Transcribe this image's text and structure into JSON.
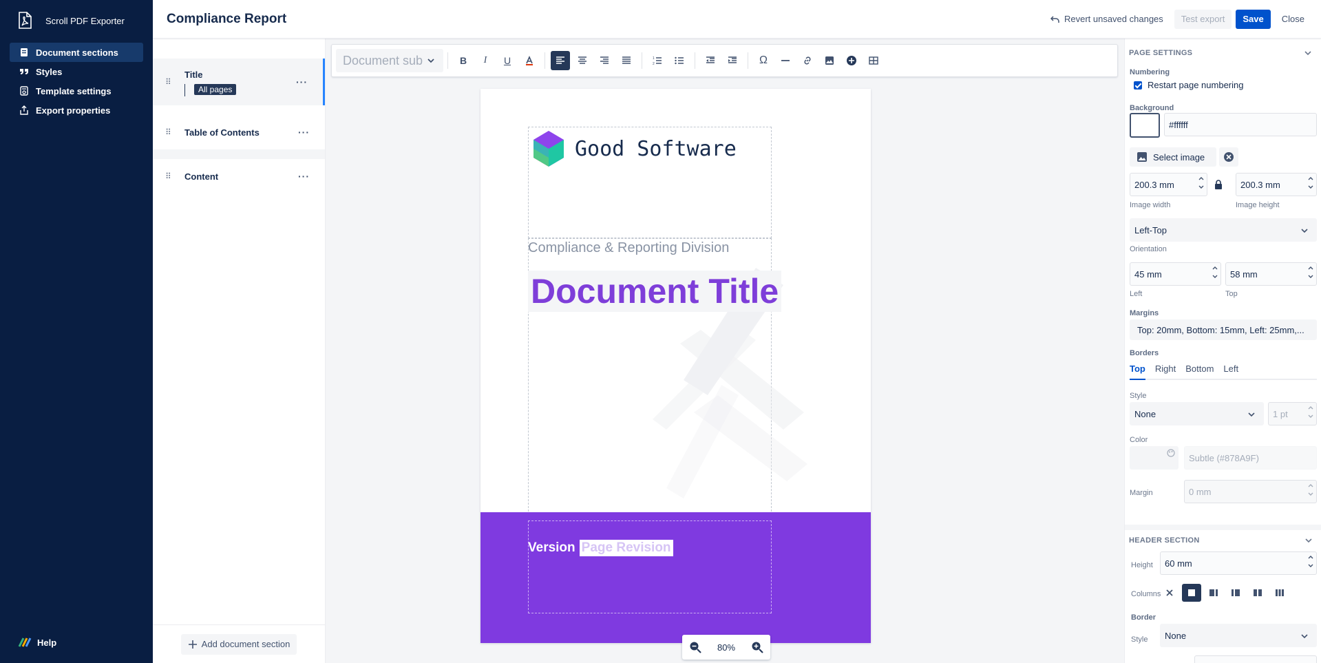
{
  "app": {
    "name": "Scroll PDF Exporter"
  },
  "nav": {
    "items": [
      {
        "label": "Document sections",
        "icon": "document-icon",
        "active": true
      },
      {
        "label": "Styles",
        "icon": "quote-icon",
        "active": false
      },
      {
        "label": "Template settings",
        "icon": "template-icon",
        "active": false
      },
      {
        "label": "Export properties",
        "icon": "export-icon",
        "active": false
      }
    ],
    "help": "Help"
  },
  "header": {
    "title": "Compliance Report",
    "revert": "Revert unsaved changes",
    "test_export": "Test export",
    "save": "Save",
    "close": "Close"
  },
  "sections": {
    "items": [
      {
        "label": "Title",
        "tag": "All pages",
        "selected": true
      },
      {
        "label": "Table of Contents"
      },
      {
        "label": "Content"
      }
    ],
    "add_label": "Add document section"
  },
  "toolbar": {
    "style_select": "Document sub"
  },
  "page": {
    "brand": "Good Software",
    "division": "Compliance & Reporting Division",
    "title": "Document Title",
    "version_label": "Version",
    "revision": "Page Revision",
    "footer_color": "#7f3ae0",
    "title_color": "#7e3ed9"
  },
  "zoom": {
    "level": "80%"
  },
  "page_settings": {
    "heading": "PAGE SETTINGS",
    "numbering_label": "Numbering",
    "restart_numbering": "Restart page numbering",
    "restart_checked": true,
    "background_label": "Background",
    "background_value": "#ffffff",
    "select_image": "Select image",
    "image_width": "200.3 mm",
    "image_width_label": "Image width",
    "image_height": "200.3 mm",
    "image_height_label": "Image height",
    "orientation_value": "Left-Top",
    "orientation_label": "Orientation",
    "left_value": "45 mm",
    "left_label": "Left",
    "top_value": "58 mm",
    "top_label": "Top",
    "margins_label": "Margins",
    "margins_value": "Top: 20mm, Bottom: 15mm, Left: 25mm,...",
    "borders_label": "Borders",
    "border_tabs": [
      "Top",
      "Right",
      "Bottom",
      "Left"
    ],
    "style_label": "Style",
    "style_value": "None",
    "width_value": "1 pt",
    "color_label": "Color",
    "color_value": "Subtle (#878A9F)",
    "margin_label": "Margin",
    "margin_value": "0 mm"
  },
  "header_section": {
    "heading": "HEADER SECTION",
    "height_label": "Height",
    "height_value": "60 mm",
    "columns_label": "Columns",
    "border_label": "Border",
    "style_label": "Style",
    "style_value": "None"
  }
}
